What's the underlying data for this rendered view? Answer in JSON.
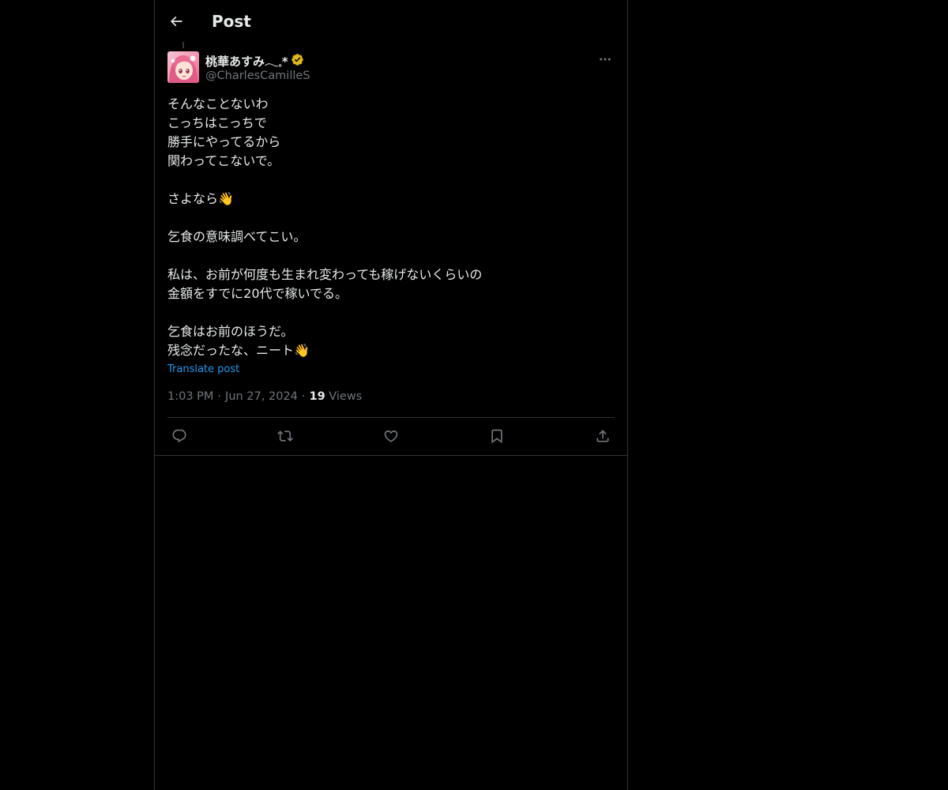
{
  "header": {
    "title": "Post"
  },
  "post": {
    "author": {
      "display_name": "桃華あすみ𓂃𓈒*",
      "handle": "@CharlesCamilleS",
      "verified": true
    },
    "text": "そんなことないわ\nこっちはこっちで\n勝手にやってるから\n関わってこないで。\n\nさよなら👋\n\n乞食の意味調べてこい。\n\n私は、お前が何度も生まれ変わっても稼げないくらいの\n金額をすでに20代で稼いでる。\n\n乞食はお前のほうだ。\n残念だったな、ニート👋",
    "translate_label": "Translate post",
    "time": "1:03 PM",
    "date": "Jun 27, 2024",
    "separator": "·",
    "views_count": "19",
    "views_label": "Views"
  },
  "actions": {
    "reply": "reply-icon",
    "repost": "repost-icon",
    "like": "heart-icon",
    "bookmark": "bookmark-icon",
    "share": "share-icon"
  },
  "colors": {
    "background": "#000000",
    "text": "#e7e9ea",
    "secondary": "#71767b",
    "link": "#1d9bf0",
    "border": "#2f3336",
    "verified_gold": "#e2b719"
  }
}
